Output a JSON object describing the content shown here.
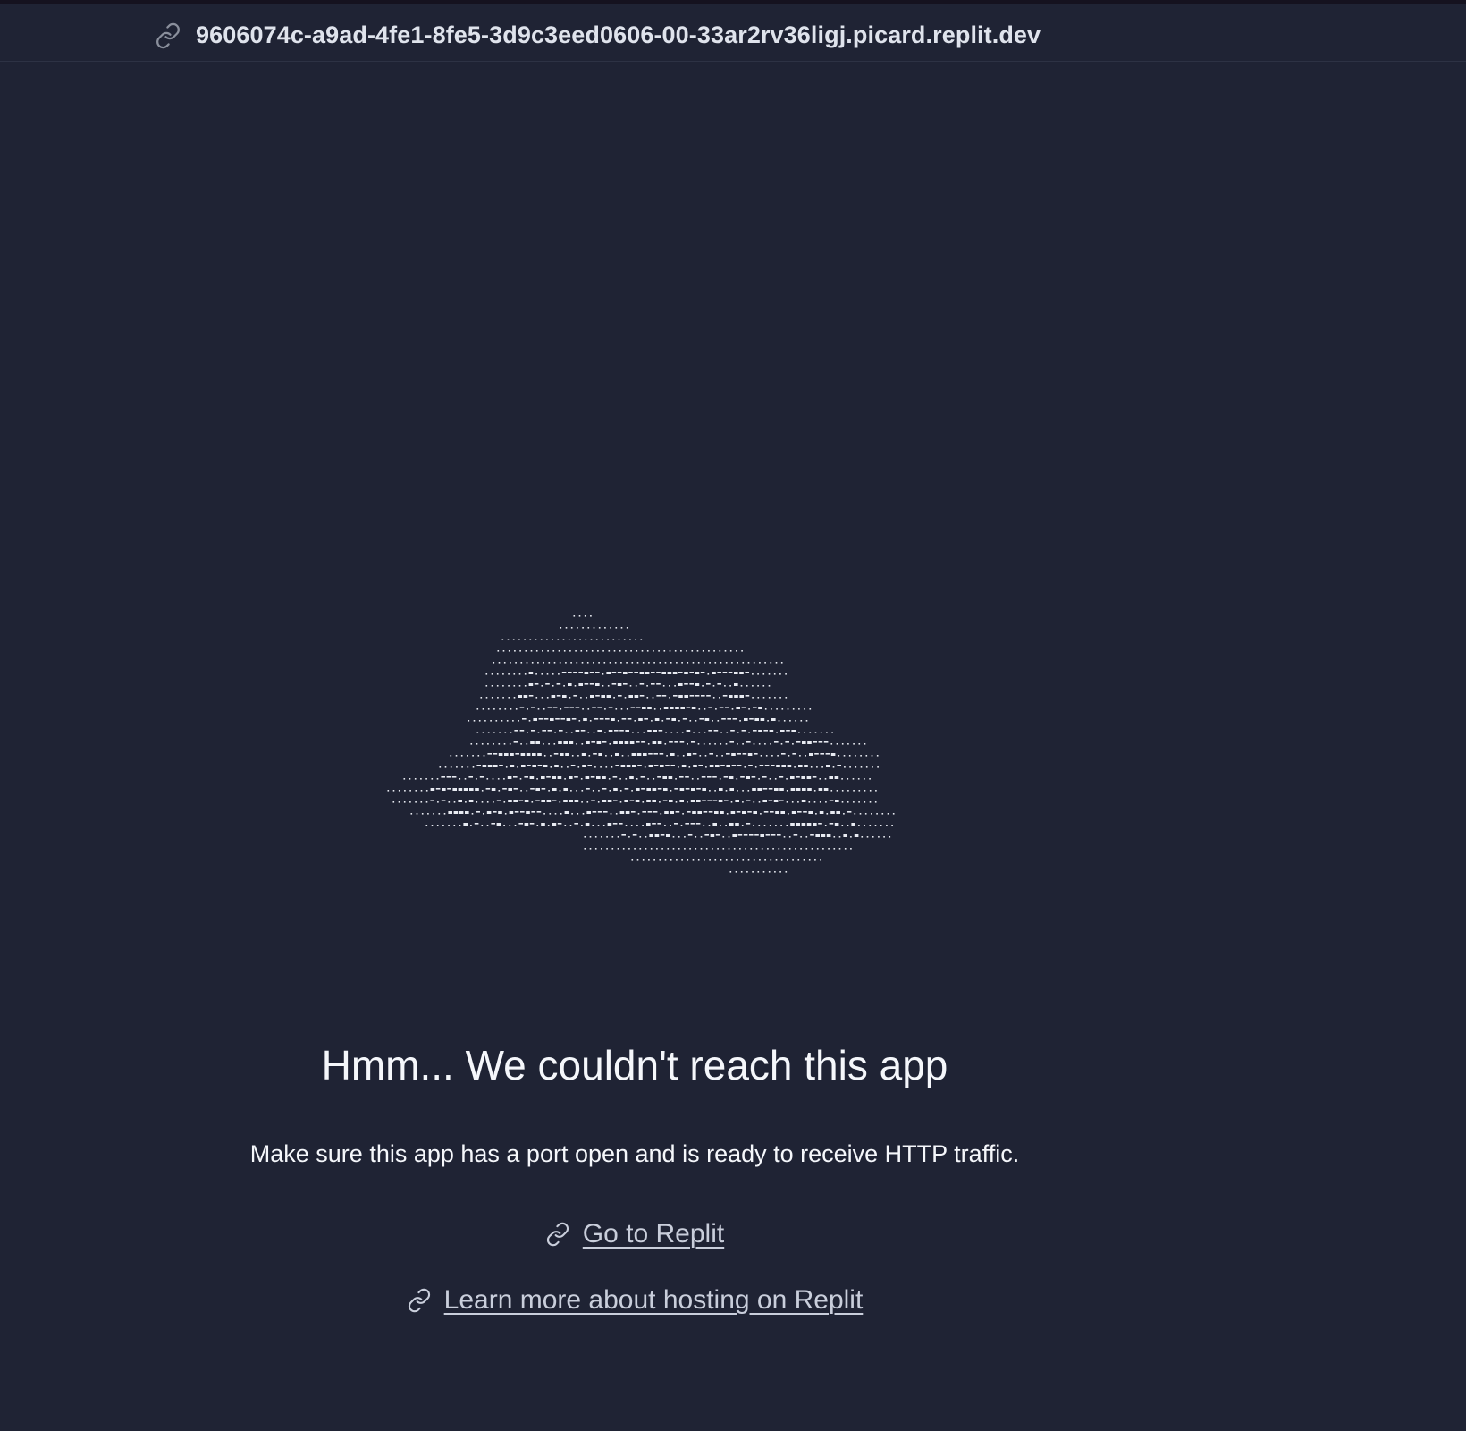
{
  "urlbar": {
    "icon": "link-icon",
    "url": "9606074c-a9ad-4fe1-8fe5-3d9c3eed0606-00-33ar2rv36ligj.picard.replit.dev"
  },
  "illustration": {
    "description_icon": "ascii-art-cloud"
  },
  "main": {
    "headline": "Hmm... We couldn't reach this app",
    "subtext": "Make sure this app has a port open and is ready to receive HTTP traffic.",
    "links": [
      {
        "label": "Go to Replit",
        "icon": "link-icon"
      },
      {
        "label": "Learn more about hosting on Replit",
        "icon": "link-icon"
      }
    ]
  },
  "colors": {
    "background": "#1f2334",
    "text": "#f5f7fb",
    "link": "#c9cedb",
    "divider": "#2d3244"
  }
}
